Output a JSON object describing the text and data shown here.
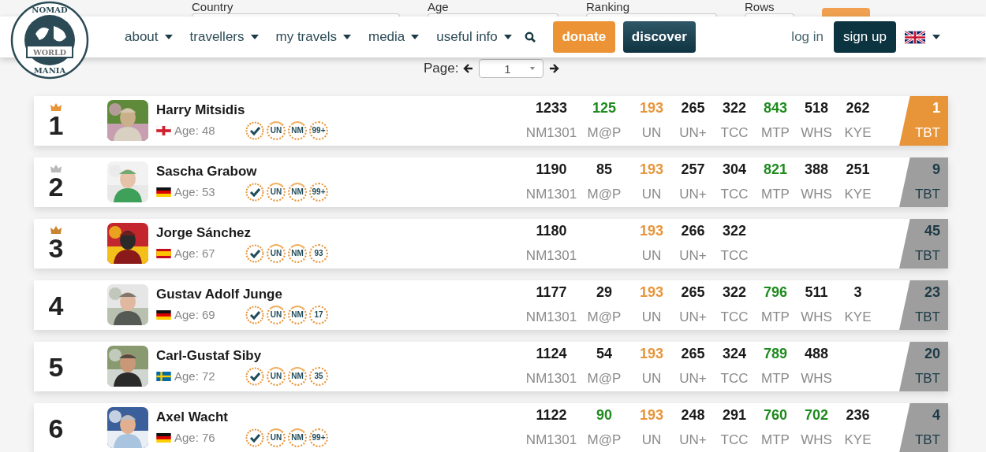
{
  "logo": {
    "top": "NOMAD",
    "middle": "WORLD",
    "bottom": "MANIA"
  },
  "filters": [
    {
      "label": "Country"
    },
    {
      "label": "Age"
    },
    {
      "label": "Ranking"
    },
    {
      "label": "Rows"
    }
  ],
  "pager": {
    "label": "Page:",
    "value": "1"
  },
  "nav": {
    "menu": [
      {
        "label": "about"
      },
      {
        "label": "travellers"
      },
      {
        "label": "my travels"
      },
      {
        "label": "media"
      },
      {
        "label": "useful info"
      }
    ],
    "donate": "donate",
    "discover": "discover",
    "login": "log in",
    "signup": "sign up"
  },
  "travellers": [
    {
      "rank": "1",
      "crown": {
        "color": "#e8953a"
      },
      "name": "Harry Mitsidis",
      "flag": {
        "kind": "england"
      },
      "age": "Age: 48",
      "badges": [
        {
          "kind": "crowned",
          "text": "UN"
        },
        {
          "kind": "crowned",
          "text": "NM"
        },
        {
          "kind": "plain",
          "text": "99+"
        }
      ],
      "stats": [
        {
          "kind": "nm1301",
          "value": "1233",
          "label": "NM1301",
          "color": "#1a1a1a"
        },
        {
          "kind": "map",
          "value": "125",
          "label": "M@P",
          "color": "#1e8a1e"
        },
        {
          "kind": "un",
          "value": "193",
          "label": "UN",
          "color": "#e8953a"
        },
        {
          "kind": "unplus",
          "value": "265",
          "label": "UN+",
          "color": "#1a1a1a"
        },
        {
          "kind": "tcc",
          "value": "322",
          "label": "TCC",
          "color": "#1a1a1a"
        },
        {
          "kind": "mtp",
          "value": "843",
          "label": "MTP",
          "color": "#1e8a1e"
        },
        {
          "kind": "whs",
          "value": "518",
          "label": "WHS",
          "color": "#1a1a1a"
        },
        {
          "kind": "kye",
          "value": "262",
          "label": "KYE",
          "color": "#1a1a1a"
        }
      ],
      "tbt": {
        "value": "1",
        "label": "TBT",
        "color": "#e8953a"
      }
    },
    {
      "rank": "2",
      "crown": {
        "color": "#b9b9b9"
      },
      "name": "Sascha Grabow",
      "flag": {
        "kind": "germany"
      },
      "age": "Age: 53",
      "badges": [
        {
          "kind": "crowned",
          "text": "UN"
        },
        {
          "kind": "crowned",
          "text": "NM"
        },
        {
          "kind": "plain",
          "text": "99+"
        }
      ],
      "stats": [
        {
          "kind": "nm1301",
          "value": "1190",
          "label": "NM1301",
          "color": "#1a1a1a"
        },
        {
          "kind": "map",
          "value": "85",
          "label": "M@P",
          "color": "#1a1a1a"
        },
        {
          "kind": "un",
          "value": "193",
          "label": "UN",
          "color": "#e8953a"
        },
        {
          "kind": "unplus",
          "value": "257",
          "label": "UN+",
          "color": "#1a1a1a"
        },
        {
          "kind": "tcc",
          "value": "304",
          "label": "TCC",
          "color": "#1a1a1a"
        },
        {
          "kind": "mtp",
          "value": "821",
          "label": "MTP",
          "color": "#1e8a1e"
        },
        {
          "kind": "whs",
          "value": "388",
          "label": "WHS",
          "color": "#1a1a1a"
        },
        {
          "kind": "kye",
          "value": "251",
          "label": "KYE",
          "color": "#1a1a1a"
        }
      ],
      "tbt": {
        "value": "9",
        "label": "TBT",
        "color": "#9e9e9e"
      }
    },
    {
      "rank": "3",
      "crown": {
        "color": "#c8842e"
      },
      "name": "Jorge Sánchez",
      "flag": {
        "kind": "spain"
      },
      "age": "Age: 67",
      "badges": [
        {
          "kind": "crowned",
          "text": "UN"
        },
        {
          "kind": "crowned",
          "text": "NM"
        },
        {
          "kind": "plain",
          "text": "93"
        }
      ],
      "stats": [
        {
          "kind": "nm1301",
          "value": "1180",
          "label": "NM1301",
          "color": "#1a1a1a"
        },
        {
          "kind": "un",
          "value": "193",
          "label": "UN",
          "color": "#e8953a"
        },
        {
          "kind": "unplus",
          "value": "266",
          "label": "UN+",
          "color": "#1a1a1a"
        },
        {
          "kind": "tcc",
          "value": "322",
          "label": "TCC",
          "color": "#1a1a1a"
        }
      ],
      "tbt": {
        "value": "45",
        "label": "TBT",
        "color": "#9e9e9e"
      }
    },
    {
      "rank": "4",
      "name": "Gustav Adolf Junge",
      "flag": {
        "kind": "germany"
      },
      "age": "Age: 69",
      "badges": [
        {
          "kind": "crowned",
          "text": "UN"
        },
        {
          "kind": "crowned",
          "text": "NM"
        },
        {
          "kind": "plain",
          "text": "17"
        }
      ],
      "stats": [
        {
          "kind": "nm1301",
          "value": "1177",
          "label": "NM1301",
          "color": "#1a1a1a"
        },
        {
          "kind": "map",
          "value": "29",
          "label": "M@P",
          "color": "#1a1a1a"
        },
        {
          "kind": "un",
          "value": "193",
          "label": "UN",
          "color": "#e8953a"
        },
        {
          "kind": "unplus",
          "value": "265",
          "label": "UN+",
          "color": "#1a1a1a"
        },
        {
          "kind": "tcc",
          "value": "322",
          "label": "TCC",
          "color": "#1a1a1a"
        },
        {
          "kind": "mtp",
          "value": "796",
          "label": "MTP",
          "color": "#1e8a1e"
        },
        {
          "kind": "whs",
          "value": "511",
          "label": "WHS",
          "color": "#1a1a1a"
        },
        {
          "kind": "kye",
          "value": "3",
          "label": "KYE",
          "color": "#1a1a1a"
        }
      ],
      "tbt": {
        "value": "23",
        "label": "TBT",
        "color": "#9e9e9e"
      }
    },
    {
      "rank": "5",
      "name": "Carl-Gustaf Siby",
      "flag": {
        "kind": "sweden"
      },
      "age": "Age: 72",
      "badges": [
        {
          "kind": "crowned",
          "text": "UN"
        },
        {
          "kind": "crowned",
          "text": "NM"
        },
        {
          "kind": "plain",
          "text": "35"
        }
      ],
      "stats": [
        {
          "kind": "nm1301",
          "value": "1124",
          "label": "NM1301",
          "color": "#1a1a1a"
        },
        {
          "kind": "map",
          "value": "54",
          "label": "M@P",
          "color": "#1a1a1a"
        },
        {
          "kind": "un",
          "value": "193",
          "label": "UN",
          "color": "#e8953a"
        },
        {
          "kind": "unplus",
          "value": "265",
          "label": "UN+",
          "color": "#1a1a1a"
        },
        {
          "kind": "tcc",
          "value": "324",
          "label": "TCC",
          "color": "#1a1a1a"
        },
        {
          "kind": "mtp",
          "value": "789",
          "label": "MTP",
          "color": "#1e8a1e"
        },
        {
          "kind": "whs",
          "value": "488",
          "label": "WHS",
          "color": "#1a1a1a"
        }
      ],
      "tbt": {
        "value": "20",
        "label": "TBT",
        "color": "#9e9e9e"
      }
    },
    {
      "rank": "6",
      "name": "Axel Wacht",
      "flag": {
        "kind": "germany"
      },
      "age": "Age: 76",
      "badges": [
        {
          "kind": "crowned",
          "text": "UN"
        },
        {
          "kind": "crowned",
          "text": "NM"
        },
        {
          "kind": "plain",
          "text": "99+"
        }
      ],
      "stats": [
        {
          "kind": "nm1301",
          "value": "1122",
          "label": "NM1301",
          "color": "#1a1a1a"
        },
        {
          "kind": "map",
          "value": "90",
          "label": "M@P",
          "color": "#1e8a1e"
        },
        {
          "kind": "un",
          "value": "193",
          "label": "UN",
          "color": "#e8953a"
        },
        {
          "kind": "unplus",
          "value": "248",
          "label": "UN+",
          "color": "#1a1a1a"
        },
        {
          "kind": "tcc",
          "value": "291",
          "label": "TCC",
          "color": "#1a1a1a"
        },
        {
          "kind": "mtp",
          "value": "760",
          "label": "MTP",
          "color": "#1e8a1e"
        },
        {
          "kind": "whs",
          "value": "702",
          "label": "WHS",
          "color": "#1e8a1e"
        },
        {
          "kind": "kye",
          "value": "236",
          "label": "KYE",
          "color": "#1a1a1a"
        }
      ],
      "tbt": {
        "value": "4",
        "label": "TBT",
        "color": "#9e9e9e"
      }
    }
  ]
}
